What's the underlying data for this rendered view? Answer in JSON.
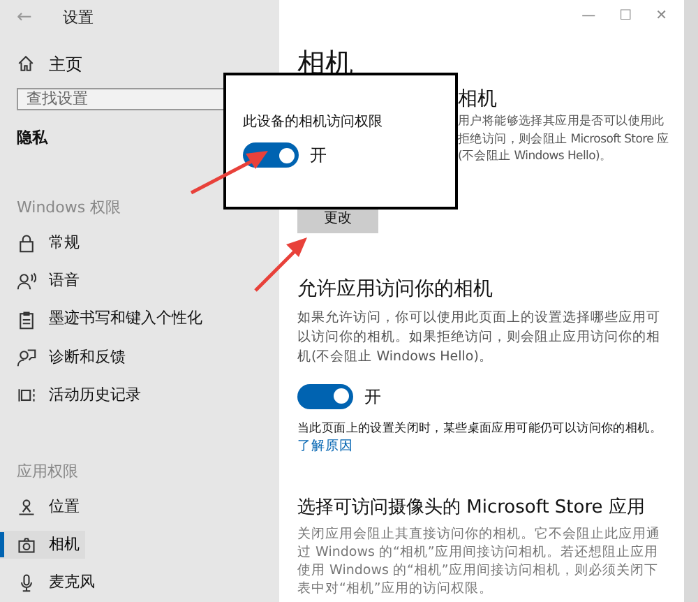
{
  "window": {
    "title": "设置",
    "back": "←",
    "controls": [
      "—",
      "☐",
      "✕"
    ]
  },
  "sidebar": {
    "home": "主页",
    "search": {
      "placeholder": "查找设置"
    },
    "section": "隐私",
    "groups": [
      {
        "heading": "Windows 权限",
        "items": [
          {
            "label": "常规",
            "kind": "lock",
            "selected": false
          },
          {
            "label": "语音",
            "kind": "speech",
            "selected": false
          },
          {
            "label": "墨迹书写和键入个性化",
            "kind": "clipboard",
            "selected": false
          },
          {
            "label": "诊断和反馈",
            "kind": "feedback",
            "selected": false
          },
          {
            "label": "活动历史记录",
            "kind": "timeline",
            "selected": false
          }
        ]
      },
      {
        "heading": "应用权限",
        "items": [
          {
            "label": "位置",
            "kind": "location",
            "selected": false
          },
          {
            "label": "相机",
            "kind": "camera",
            "selected": true
          },
          {
            "label": "麦克风",
            "kind": "mic",
            "selected": false
          }
        ]
      }
    ]
  },
  "content": {
    "title": "相机",
    "device_section": {
      "heading": "相机",
      "description_lines": [
        "用户将能够选择其应用是否可以使用此",
        "拒绝访问，则会阻止 Microsoft Store 应",
        "(不会阻止 Windows Hello)。"
      ],
      "button": "更改"
    },
    "apps_section": {
      "heading": "允许应用访问你的相机",
      "description": "如果允许访问，你可以使用此页面上的设置选择哪些应用可以访问你的相机。如果拒绝访问，则会阻止应用访问你的相机(不会阻止 Windows Hello)。",
      "toggle": {
        "on": true,
        "label": "开"
      },
      "note": "当此页面上的设置关闭时，某些桌面应用可能仍可以访问你的相机。",
      "link": "了解原因"
    },
    "store_section": {
      "heading": "选择可访问摄像头的 Microsoft Store 应用",
      "description": "关闭应用会阻止其直接访问你的相机。它不会阻止此应用通过 Windows 的“相机”应用间接访问相机。若还想阻止应用使用 Windows 的“相机”应用间接访问相机，则必须关闭下表中对“相机”应用的访问权限。"
    }
  },
  "popup": {
    "title": "此设备的相机访问权限",
    "toggle": {
      "on": true,
      "label": "开"
    }
  }
}
